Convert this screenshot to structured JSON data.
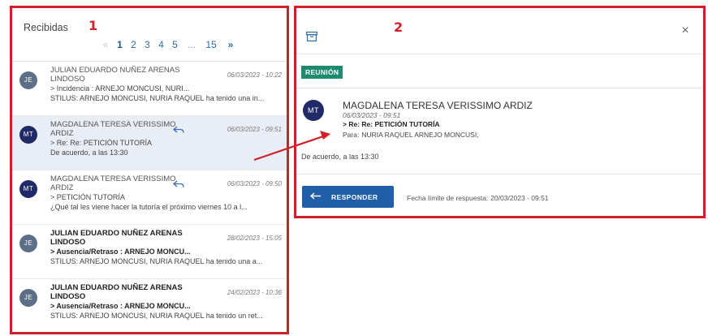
{
  "inbox": {
    "title": "Recibidas",
    "pagination": {
      "prev": "«",
      "pages": [
        "1",
        "2",
        "3",
        "4",
        "5"
      ],
      "active_page": "1",
      "ellipsis": "...",
      "last_page": "15",
      "next": "»"
    },
    "messages": [
      {
        "initials": "JE",
        "sender_line1": "JULIAN EDUARDO NUÑEZ ARENAS",
        "sender_line2": "LINDOSO",
        "date": "06/03/2023 - 10:22",
        "subject": "> Incidencia : ARNEJO MONCUSI, NURI...",
        "preview": "STILUS: ARNEJO MONCUSI, NURIA RAQUEL ha tenido una in..."
      },
      {
        "initials": "MT",
        "sender_line1": "MAGDALENA TERESA VERISSIMO",
        "sender_line2": "ARDIZ",
        "date": "06/03/2023 - 09:51",
        "subject": "> Re: Re: PETICIÓN TUTORÍA",
        "preview": "De acuerdo, a las 13:30"
      },
      {
        "initials": "MT",
        "sender_line1": "MAGDALENA TERESA VERISSIMO",
        "sender_line2": "ARDIZ",
        "date": "06/03/2023 - 09:50",
        "subject": "> PETICIÓN TUTORÍA",
        "preview": "¿Qué tal les viene hacer la tutoría el próximo viernes 10 a l..."
      },
      {
        "initials": "JE",
        "sender_line1": "JULIAN EDUARDO NUÑEZ ARENAS",
        "sender_line2": "LINDOSO",
        "date": "28/02/2023 - 15:05",
        "subject": "> Ausencia/Retraso : ARNEJO MONCU...",
        "preview": "STILUS: ARNEJO MONCUSI, NURIA RAQUEL ha tenido una a..."
      },
      {
        "initials": "JE",
        "sender_line1": "JULIAN EDUARDO NUÑEZ ARENAS",
        "sender_line2": "LINDOSO",
        "date": "24/02/2023 - 10:36",
        "subject": "> Ausencia/Retraso : ARNEJO MONCU...",
        "preview": "STILUS: ARNEJO MONCUSI, NURIA RAQUEL ha tenido un ret..."
      }
    ]
  },
  "detail": {
    "tag": "REUNIÓN",
    "initials": "MT",
    "sender": "MAGDALENA TERESA VERISSIMO ARDIZ",
    "date": "06/03/2023 - 09:51",
    "subject": "> Re: Re: PETICIÓN TUTORÍA",
    "to_label": "Para:",
    "to_value": "NURIA RAQUEL ARNEJO MONCUSI;",
    "body": "De acuerdo, a las 13:30",
    "reply_label": "RESPONDER",
    "deadline_label": "Fecha límite de respuesta:",
    "deadline_value": "20/03/2023 - 09:51",
    "close_glyph": "×"
  },
  "annotations": {
    "label_1": "1",
    "label_2": "2"
  },
  "colors": {
    "annotation_red": "#d0202a",
    "tag_green": "#1e8a6e",
    "button_blue": "#1f5fa8",
    "avatar_navy": "#1f2a66",
    "avatar_slate": "#5c6f86",
    "selected_row": "#e9eef6"
  },
  "icons": {
    "archive": "archive-icon",
    "close": "close-icon",
    "reply": "reply-arrow-icon"
  }
}
